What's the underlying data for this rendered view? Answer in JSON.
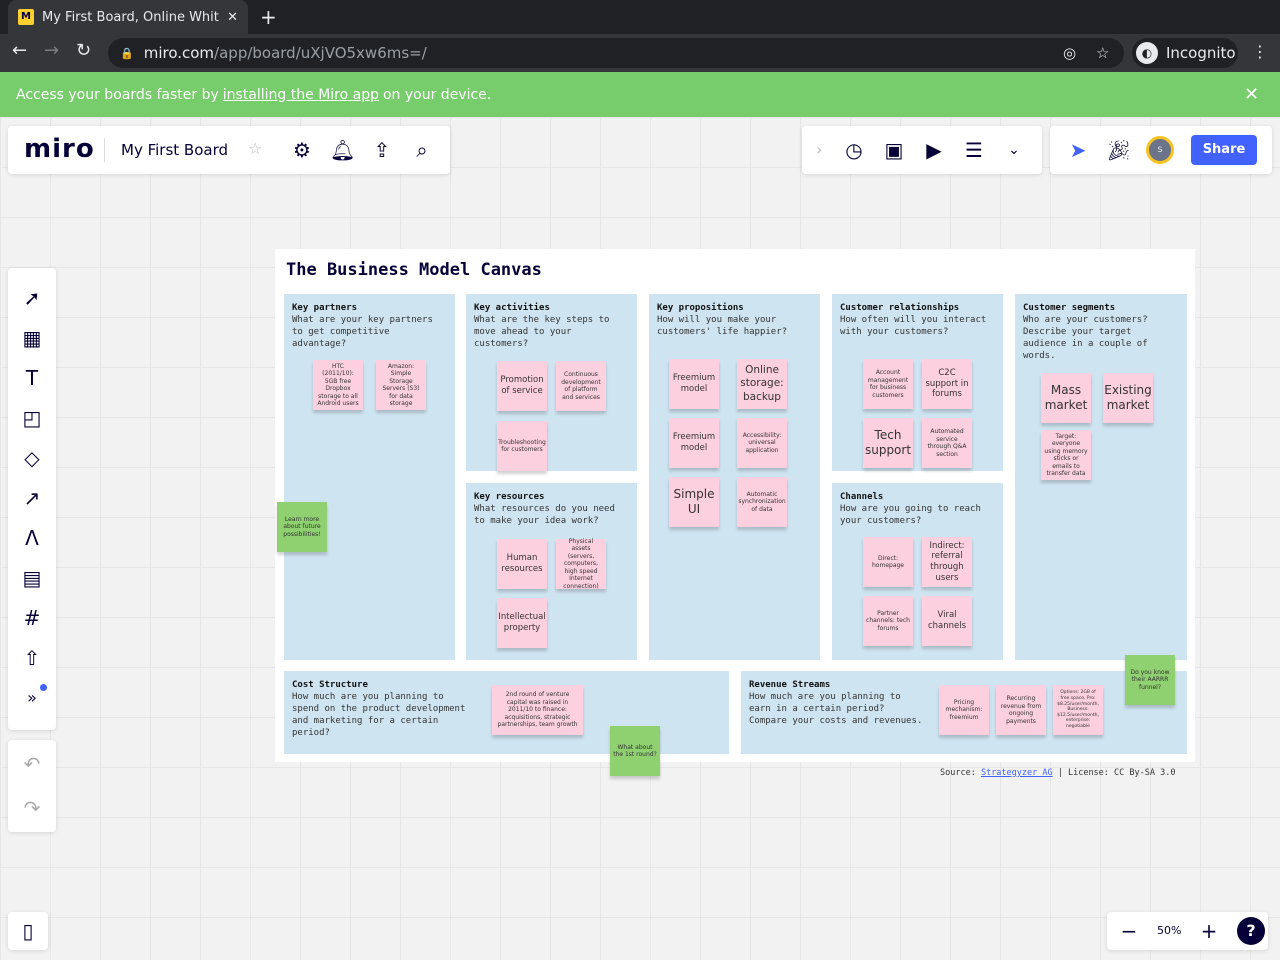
{
  "browser": {
    "tab_title": "My First Board, Online Whiteboard",
    "url_host": "miro.com",
    "url_path": "/app/board/uXjVO5xw6ms=/",
    "profile": "Incognito"
  },
  "banner": {
    "before": "Access your boards faster by",
    "link": "installing the Miro app",
    "after": "on your device."
  },
  "header": {
    "logo": "miro",
    "board_name": "My First Board",
    "share_label": "Share",
    "avatar_initial": "s"
  },
  "zoom": {
    "level": "50%"
  },
  "colors": {
    "accent": "#4262ff",
    "banner": "#77cc6b",
    "section": "#cfe4f1",
    "sticky_pink": "#fdd0e0",
    "sticky_green": "#8fd070"
  },
  "board": {
    "title": "The Business Model Canvas",
    "sections": [
      {
        "title": "Key partners",
        "question": "What are your key partners to get competitive advantage?"
      },
      {
        "title": "Key activities",
        "question": "What are the key steps to move ahead to your customers?"
      },
      {
        "title": "Key resources",
        "question": "What resources do you need to make your idea work?"
      },
      {
        "title": "Key propositions",
        "question": "How will you make your customers' life happier?"
      },
      {
        "title": "Customer relationships",
        "question": "How often will you interact with your customers?"
      },
      {
        "title": "Channels",
        "question": "How are you going to reach your customers?"
      },
      {
        "title": "Customer segments",
        "question": "Who are your customers? Describe your target audience in a couple of words."
      },
      {
        "title": "Cost Structure",
        "question": "How much are you planning to spend on the product development and marketing for a certain period?"
      },
      {
        "title": "Revenue Streams",
        "question": "How much are you planning to earn in a certain period? Compare your costs and revenues."
      }
    ],
    "stickies": [
      "HTC (2011/10): 5GB free Dropbox storage to all Android users",
      "Amazon: Simple Storage Servers (S3) for data storage",
      "Learn more about future possibilities!",
      "Promotion of service",
      "Continuous development of platform and services",
      "Troubleshooting for customers",
      "Human resources",
      "Physical assets (servers, computers, high speed Internet connection)",
      "Intellectual property",
      "Freemium model",
      "Online storage: backup",
      "Freemium model",
      "Accessibility: universal application",
      "Simple UI",
      "Automatic synchronization of data",
      "Account management for business customers",
      "C2C support in forums",
      "Tech support",
      "Automated service through Q&A section",
      "Direct: homepage",
      "Indirect: referral through users",
      "Partner channels: tech forums",
      "Viral channels",
      "Mass market",
      "Existing market",
      "Target: everyone using memory sticks or emails to transfer data",
      "2nd round of venture capital was raised in 2011/10 to finance: acquisitions, strategic partnerships, team growth",
      "What about the 1st round?",
      "Pricing mechanism: freemium",
      "Recurring revenue from ongoing payments",
      "Options: 2GB of free space, Pro: $8.25/user/month, Business: $12.5/user/month, enterprise: negotiable",
      "Do you know their AARRR funnel?"
    ],
    "source_prefix": "Source:",
    "source_link": "Strategyzer AG",
    "license": "| License: CC By-SA 3.0"
  }
}
